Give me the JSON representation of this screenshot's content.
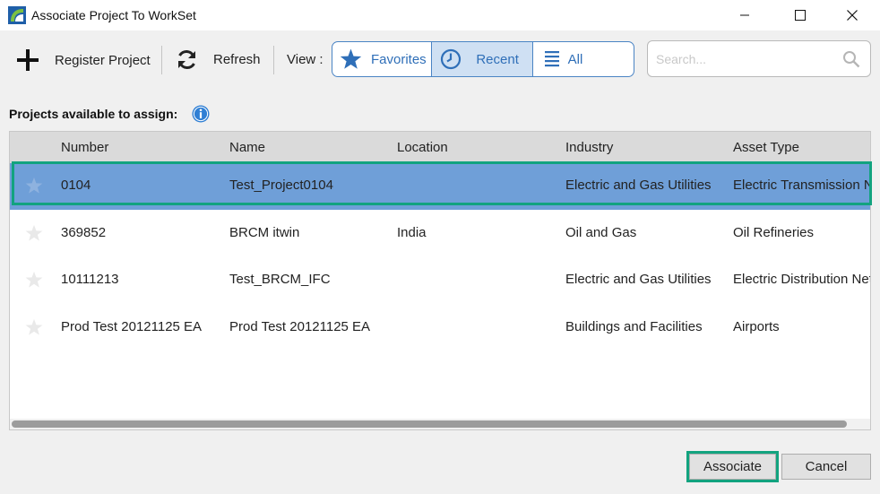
{
  "window": {
    "title": "Associate Project To WorkSet"
  },
  "toolbar": {
    "register_label": "Register Project",
    "refresh_label": "Refresh",
    "view_label": "View :",
    "view_options": {
      "favorites": "Favorites",
      "recent": "Recent",
      "all": "All"
    },
    "selected_view": "Recent",
    "search_placeholder": "Search..."
  },
  "section": {
    "label": "Projects available to assign:"
  },
  "table": {
    "columns": {
      "number": "Number",
      "name": "Name",
      "location": "Location",
      "industry": "Industry",
      "asset_type": "Asset Type"
    },
    "rows": [
      {
        "number": "0104",
        "name": "Test_Project0104",
        "location": "",
        "industry": "Electric and Gas Utilities",
        "asset_type": "Electric Transmission Network",
        "selected": true
      },
      {
        "number": "369852",
        "name": "BRCM itwin",
        "location": "India",
        "industry": "Oil and Gas",
        "asset_type": "Oil Refineries",
        "selected": false
      },
      {
        "number": "10111213",
        "name": "Test_BRCM_IFC",
        "location": "",
        "industry": "Electric and Gas Utilities",
        "asset_type": "Electric Distribution Network",
        "selected": false
      },
      {
        "number": "Prod Test 20121125 EA",
        "name": "Prod Test 20121125 EA",
        "location": "",
        "industry": "Buildings and Facilities",
        "asset_type": "Airports",
        "selected": false
      }
    ]
  },
  "footer": {
    "associate_label": "Associate",
    "cancel_label": "Cancel"
  },
  "colors": {
    "accent": "#2f6fb8",
    "selected_row": "#6f9fd8",
    "highlight_outline": "#12a37f"
  }
}
